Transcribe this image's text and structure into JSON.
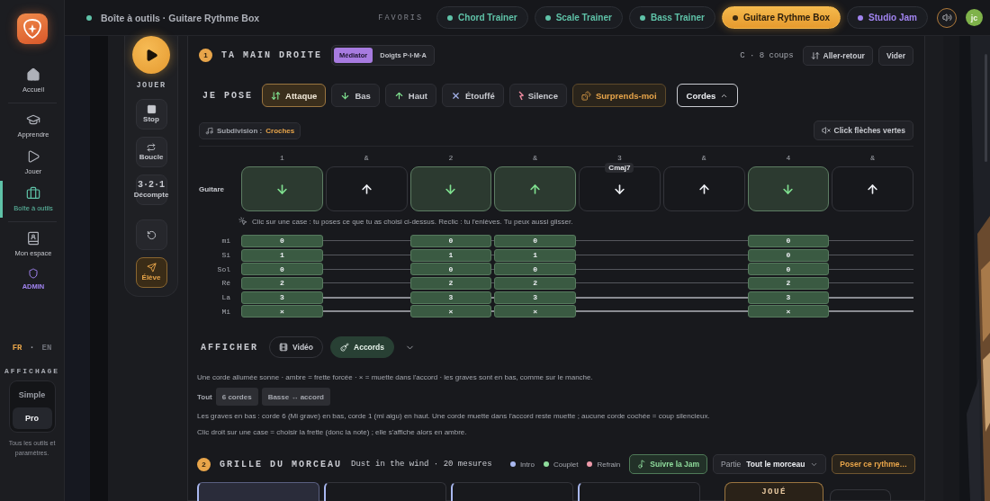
{
  "sidebar": {
    "items": [
      {
        "label": "Accueil",
        "selected": false
      },
      {
        "label": "Apprendre",
        "selected": false
      },
      {
        "label": "Jouer",
        "selected": false
      },
      {
        "label": "Boîte à outils",
        "selected": true
      },
      {
        "label": "Mon espace",
        "selected": false
      },
      {
        "label": "ADMIN",
        "selected": false
      }
    ],
    "languages": [
      {
        "label": "FR",
        "selected": true
      },
      {
        "label": "EN",
        "selected": false
      }
    ],
    "language_separator": "·",
    "display_title": "AFFICHAGE",
    "display_modes": [
      {
        "label": "Simple",
        "selected": false
      },
      {
        "label": "Pro",
        "selected": true
      }
    ],
    "display_note": "Tous les outils et paramètres."
  },
  "topbar": {
    "breadcrumb": "Boîte à outils · Guitare Rythme Box",
    "favorites_label": "FAVORIS",
    "favorites": [
      {
        "label": "Chord Trainer",
        "color": "#5fc2a8",
        "selected": false
      },
      {
        "label": "Scale Trainer",
        "color": "#5fc2a8",
        "selected": false
      },
      {
        "label": "Bass Trainer",
        "color": "#5fc2a8",
        "selected": false
      },
      {
        "label": "Guitare Rythme Box",
        "color": "#3a2a10",
        "selected": true
      },
      {
        "label": "Studio Jam",
        "color": "#a184f0",
        "selected": false
      }
    ],
    "avatar": "jc"
  },
  "transport": {
    "play_label": "JOUER",
    "buttons": [
      {
        "kind": "stop",
        "label": "Stop",
        "active": false
      },
      {
        "kind": "loop",
        "label": "Boucle",
        "active": false
      },
      {
        "kind": "countdown",
        "value": "3·2·1",
        "label": "Décompte",
        "active": false
      },
      {
        "kind": "reset",
        "active": false
      },
      {
        "kind": "student",
        "label": "Élève",
        "active": true
      }
    ]
  },
  "section1": {
    "number": "1",
    "title": "TA MAIN DROITE",
    "hand_modes": [
      {
        "label": "Médiator",
        "selected": true
      },
      {
        "label": "Doigts P·I·M·A",
        "selected": false
      }
    ],
    "summary": "C · 8 coups",
    "actions": [
      {
        "kind": "swap",
        "label": "Aller-retour"
      },
      {
        "kind": "plain",
        "label": "Vider"
      }
    ],
    "pose_label": "JE POSE",
    "strokes": [
      {
        "kind": "attack",
        "label": "Attaque",
        "selected": true
      },
      {
        "kind": "down",
        "label": "Bas",
        "selected": false
      },
      {
        "kind": "up",
        "label": "Haut",
        "selected": false
      },
      {
        "kind": "mute",
        "label": "Étouffé",
        "selected": false
      },
      {
        "kind": "rest",
        "label": "Silence",
        "selected": false
      },
      {
        "kind": "random",
        "label": "Surprends-moi",
        "selected": false
      },
      {
        "kind": "menu",
        "label": "Cordes",
        "expanded": true
      }
    ],
    "subdivision": {
      "label": "Subdivision :",
      "value": "Croches"
    },
    "click": {
      "label": "Click flèches vertes",
      "muted": true
    },
    "beats": [
      "1",
      "&",
      "2",
      "&",
      "3",
      "&",
      "4",
      "&"
    ],
    "track_label": "Guitare",
    "steps": [
      {
        "kind": "down",
        "on": true,
        "frets": [
          "0",
          "1",
          "0",
          "2",
          "3",
          "×"
        ]
      },
      {
        "kind": "up",
        "on": false
      },
      {
        "kind": "down",
        "on": true,
        "frets": [
          "0",
          "1",
          "0",
          "2",
          "3",
          "×"
        ]
      },
      {
        "kind": "up",
        "on": true,
        "frets": [
          "0",
          "1",
          "0",
          "2",
          "3",
          "×"
        ]
      },
      {
        "kind": "down",
        "on": false,
        "chord": "Cmaj7"
      },
      {
        "kind": "up",
        "on": false
      },
      {
        "kind": "down",
        "on": true,
        "frets": [
          "0",
          "0",
          "0",
          "2",
          "3",
          "×"
        ]
      },
      {
        "kind": "up",
        "on": false
      }
    ],
    "hint": "Clic sur une case : tu poses ce que tu as choisi ci-dessus. Reclic : tu l'enlèves. Tu peux aussi glisser.",
    "strings": [
      "mi",
      "Si",
      "Sol",
      "Ré",
      "La",
      "Mi"
    ]
  },
  "display": {
    "label": "AFFICHER",
    "options": [
      {
        "kind": "video",
        "label": "Vidéo",
        "selected": false
      },
      {
        "kind": "chords",
        "label": "Accords",
        "selected": true
      }
    ],
    "legend": "Une corde allumée sonne · ambre = frette forcée · × = muette dans l'accord · les graves sont en bas, comme sur le manche.",
    "filter_label": "Tout",
    "filters": [
      "6 cordes",
      "Basse ↔ accord"
    ],
    "notes": [
      "Les graves en bas : corde 6 (Mi grave) en bas, corde 1 (mi aigu) en haut. Une corde muette dans l'accord reste muette ; aucune corde cochée = coup silencieux.",
      "Clic droit sur une case = choisir la frette (donc la note) ; elle s'affiche alors en ambre."
    ]
  },
  "section2": {
    "number": "2",
    "title": "GRILLE DU MORCEAU",
    "song": "Dust in the wind · 20 mesures",
    "legend": [
      {
        "label": "Intro",
        "color": "#a9b8f0"
      },
      {
        "label": "Couplet",
        "color": "#8fdc9c"
      },
      {
        "label": "Refrain",
        "color": "#ee9aaa"
      }
    ],
    "follow": "Suivre la Jam",
    "part_label": "Partie",
    "part_value": "Tout le morceau",
    "apply": "Poser ce rythme…",
    "tiles": [
      {
        "selected": true
      },
      {
        "selected": false
      },
      {
        "selected": false
      },
      {
        "selected": false
      }
    ],
    "played_label": "JOUÉ"
  }
}
